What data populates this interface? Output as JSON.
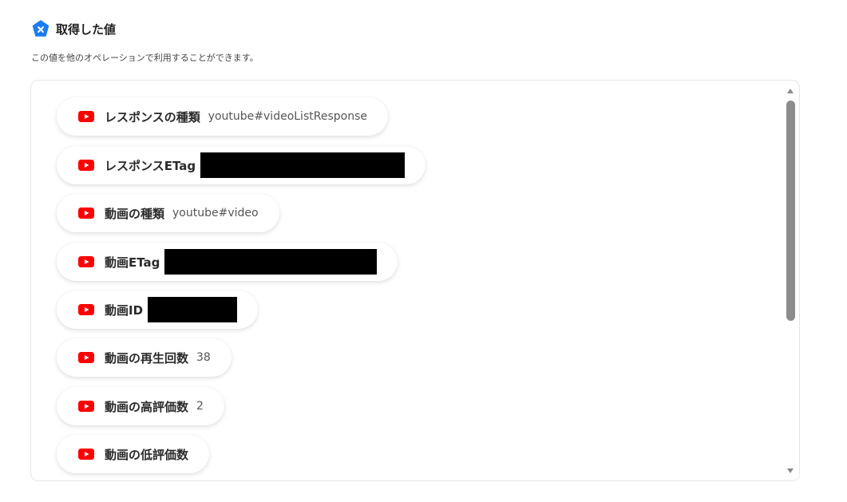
{
  "header": {
    "title": "取得した値",
    "icon": "x-badge-icon",
    "accent": "#1a7cf3"
  },
  "subtitle": "この値を他のオペレーションで利用することができます。",
  "items": [
    {
      "label": "レスポンスの種類",
      "value": "youtube#videoListResponse",
      "redacted": false
    },
    {
      "label": "レスポンスETag",
      "value": "",
      "redacted": true
    },
    {
      "label": "動画の種類",
      "value": "youtube#video",
      "redacted": false
    },
    {
      "label": "動画ETag",
      "value": "",
      "redacted": true
    },
    {
      "label": "動画ID",
      "value": "",
      "redacted": true
    },
    {
      "label": "動画の再生回数",
      "value": "38",
      "redacted": false
    },
    {
      "label": "動画の高評価数",
      "value": "2",
      "redacted": false
    },
    {
      "label": "動画の低評価数",
      "value": "",
      "redacted": false
    }
  ],
  "colors": {
    "youtube_red": "#ff0000",
    "redaction": "#000000"
  }
}
